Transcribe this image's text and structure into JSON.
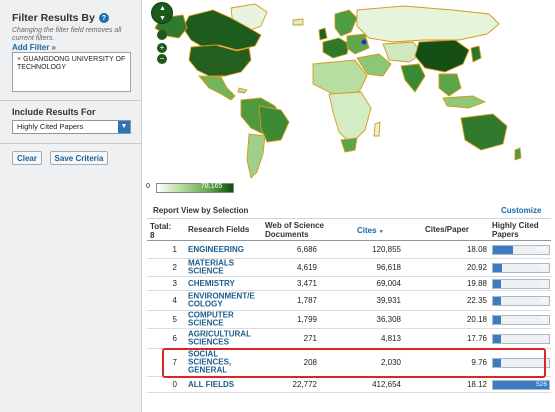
{
  "sidebar": {
    "title": "Filter Results By",
    "note": "Changing the filter field removes all current filters.",
    "add_filter": "Add Filter »",
    "filter_remove": "×",
    "filter_value": "GUANGDONG UNIVERSITY OF TECHNOLOGY",
    "include_title": "Include Results For",
    "include_value": "Highly Cited Papers",
    "clear_label": "Clear",
    "save_label": "Save Criteria"
  },
  "map": {
    "legend_min": "0",
    "legend_max": "78,165"
  },
  "report": {
    "title": "Report View by Selection",
    "customize": "Customize",
    "headers": {
      "total": "Total: 8",
      "field": "Research Fields",
      "docs": "Web of Science Documents",
      "cites": "Cites",
      "cites_sort": "▼",
      "cpp": "Cites/Paper",
      "hcp": "Highly Cited Papers"
    },
    "rows": [
      {
        "rank": "1",
        "field": "ENGINEERING",
        "docs": "6,686",
        "cites": "120,855",
        "cpp": "18.08",
        "hcp": "190",
        "hcp_value": 190
      },
      {
        "rank": "2",
        "field": "MATERIALS SCIENCE",
        "docs": "4,619",
        "cites": "96,618",
        "cpp": "20.92",
        "hcp": "89",
        "hcp_value": 89
      },
      {
        "rank": "3",
        "field": "CHEMISTRY",
        "docs": "3,471",
        "cites": "69,004",
        "cpp": "19.88",
        "hcp": "74",
        "hcp_value": 74
      },
      {
        "rank": "4",
        "field": "ENVIRONMENT/ECOLOGY",
        "docs": "1,787",
        "cites": "39,931",
        "cpp": "22.35",
        "hcp": "43",
        "hcp_value": 43
      },
      {
        "rank": "5",
        "field": "COMPUTER SCIENCE",
        "docs": "1,799",
        "cites": "36,308",
        "cpp": "20.18",
        "hcp": "62",
        "hcp_value": 62
      },
      {
        "rank": "6",
        "field": "AGRICULTURAL SCIENCES",
        "docs": "271",
        "cites": "4,813",
        "cpp": "17.76",
        "hcp": "7",
        "hcp_value": 7
      },
      {
        "rank": "7",
        "field": "SOCIAL SCIENCES, GENERAL",
        "docs": "208",
        "cites": "2,030",
        "cpp": "9.76",
        "hcp": "7",
        "hcp_value": 7
      },
      {
        "rank": "0",
        "field": "ALL FIELDS",
        "docs": "22,772",
        "cites": "412,654",
        "cpp": "18.12",
        "hcp": "526",
        "hcp_value": 526
      }
    ]
  },
  "colors": {
    "accent_blue": "#1a6aa5",
    "bar_blue": "#3d7bc4",
    "highlight_red": "#d72825",
    "map_dark_green": "#0d4f0d"
  }
}
